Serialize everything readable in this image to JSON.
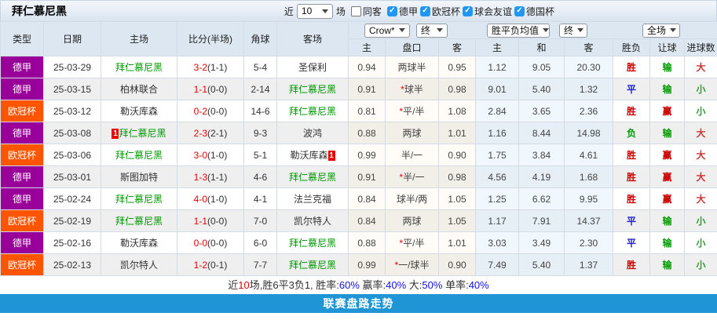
{
  "top_bar": {
    "title": "拜仁慕尼黑",
    "recent_prefix": "近",
    "recent_count": "10",
    "recent_suffix": "场",
    "same_away": {
      "label": "同客",
      "checked": false
    },
    "filters": [
      {
        "label": "德甲",
        "checked": true
      },
      {
        "label": "欧冠杯",
        "checked": true
      },
      {
        "label": "球会友谊",
        "checked": true
      },
      {
        "label": "德国杯",
        "checked": true
      }
    ]
  },
  "header": {
    "cols": [
      "类型",
      "日期",
      "主场",
      "比分(半场)",
      "角球",
      "客场"
    ],
    "selects": [
      {
        "value": "Crow*"
      },
      {
        "value": "终"
      },
      {
        "value": "胜平负均值"
      },
      {
        "value": "终"
      },
      {
        "value": "全场"
      }
    ],
    "subcols": [
      "主",
      "盘口",
      "客",
      "主",
      "和",
      "客",
      "胜负",
      "让球",
      "进球数"
    ]
  },
  "colors": {
    "bundesliga_badge": "#990099",
    "ucl_badge": "#ff5500",
    "team_highlight": "#009900",
    "score_red": "#e60000",
    "accent_bar": "#2095d5",
    "percent_blue": "#1111dd"
  },
  "rows": [
    {
      "cells": [
        {
          "t": "德甲",
          "cls": "type-dejia"
        },
        {
          "t": "25-03-29"
        },
        {
          "t": "拜仁慕尼黑",
          "color": "g"
        },
        {
          "t": "3-2",
          "color": "r",
          "half": "(1-1)"
        },
        {
          "t": "5-4"
        },
        {
          "t": "圣保利"
        },
        {
          "t": "0.94"
        },
        {
          "t": "两球半"
        },
        {
          "t": "0.95"
        },
        {
          "t": "1.12"
        },
        {
          "t": "9.05"
        },
        {
          "t": "20.30"
        },
        {
          "t": "胜",
          "color": "rb"
        },
        {
          "t": "输",
          "color": "gb"
        },
        {
          "t": "大",
          "color": "or"
        }
      ]
    },
    {
      "cells": [
        {
          "t": "德甲",
          "cls": "type-dejia"
        },
        {
          "t": "25-03-15"
        },
        {
          "t": "柏林联合"
        },
        {
          "t": "1-1",
          "color": "r",
          "half": "(0-0)"
        },
        {
          "t": "2-14"
        },
        {
          "t": "拜仁慕尼黑",
          "color": "g"
        },
        {
          "t": "0.91"
        },
        {
          "star": "*",
          "t": "球半"
        },
        {
          "t": "0.98"
        },
        {
          "t": "9.01"
        },
        {
          "t": "5.40"
        },
        {
          "t": "1.32"
        },
        {
          "t": "平",
          "color": "bb"
        },
        {
          "t": "输",
          "color": "gb"
        },
        {
          "t": "小",
          "color": "ug"
        }
      ]
    },
    {
      "cells": [
        {
          "t": "欧冠杯",
          "cls": "type-ouguan"
        },
        {
          "t": "25-03-12"
        },
        {
          "t": "勒沃库森"
        },
        {
          "t": "0-2",
          "color": "r",
          "half": "(0-0)"
        },
        {
          "t": "14-6"
        },
        {
          "t": "拜仁慕尼黑",
          "color": "g"
        },
        {
          "t": "0.81"
        },
        {
          "star": "*",
          "t": "平/半"
        },
        {
          "t": "1.08"
        },
        {
          "t": "2.84"
        },
        {
          "t": "3.65"
        },
        {
          "t": "2.36"
        },
        {
          "t": "胜",
          "color": "rb"
        },
        {
          "t": "赢",
          "color": "rb"
        },
        {
          "t": "小",
          "color": "ug"
        }
      ]
    },
    {
      "cells": [
        {
          "t": "德甲",
          "cls": "type-dejia"
        },
        {
          "t": "25-03-08"
        },
        {
          "t": "拜仁慕尼黑",
          "color": "g",
          "badge": {
            "pos": "before",
            "t": "1"
          }
        },
        {
          "t": "2-3",
          "color": "r",
          "half": "(2-1)"
        },
        {
          "t": "9-3"
        },
        {
          "t": "波鸿"
        },
        {
          "t": "0.88"
        },
        {
          "t": "两球"
        },
        {
          "t": "1.01"
        },
        {
          "t": "1.16"
        },
        {
          "t": "8.44"
        },
        {
          "t": "14.98"
        },
        {
          "t": "负",
          "color": "gb"
        },
        {
          "t": "输",
          "color": "gb"
        },
        {
          "t": "大",
          "color": "or"
        }
      ]
    },
    {
      "cells": [
        {
          "t": "欧冠杯",
          "cls": "type-ouguan"
        },
        {
          "t": "25-03-06"
        },
        {
          "t": "拜仁慕尼黑",
          "color": "g"
        },
        {
          "t": "3-0",
          "color": "r",
          "half": "(1-0)"
        },
        {
          "t": "5-1"
        },
        {
          "t": "勒沃库森",
          "badge": {
            "pos": "after",
            "t": "1"
          }
        },
        {
          "t": "0.99"
        },
        {
          "t": "半/一"
        },
        {
          "t": "0.90"
        },
        {
          "t": "1.75"
        },
        {
          "t": "3.84"
        },
        {
          "t": "4.61"
        },
        {
          "t": "胜",
          "color": "rb"
        },
        {
          "t": "赢",
          "color": "rb"
        },
        {
          "t": "大",
          "color": "or"
        }
      ]
    },
    {
      "cells": [
        {
          "t": "德甲",
          "cls": "type-dejia"
        },
        {
          "t": "25-03-01"
        },
        {
          "t": "斯图加特"
        },
        {
          "t": "1-3",
          "color": "r",
          "half": "(1-1)"
        },
        {
          "t": "4-6"
        },
        {
          "t": "拜仁慕尼黑",
          "color": "g"
        },
        {
          "t": "0.91"
        },
        {
          "star": "*",
          "t": "半/一"
        },
        {
          "t": "0.98"
        },
        {
          "t": "4.56"
        },
        {
          "t": "4.19"
        },
        {
          "t": "1.68"
        },
        {
          "t": "胜",
          "color": "rb"
        },
        {
          "t": "赢",
          "color": "rb"
        },
        {
          "t": "大",
          "color": "or"
        }
      ]
    },
    {
      "cells": [
        {
          "t": "德甲",
          "cls": "type-dejia"
        },
        {
          "t": "25-02-24"
        },
        {
          "t": "拜仁慕尼黑",
          "color": "g"
        },
        {
          "t": "4-0",
          "color": "r",
          "half": "(1-0)"
        },
        {
          "t": "4-1"
        },
        {
          "t": "法兰克福"
        },
        {
          "t": "0.84"
        },
        {
          "t": "球半/两"
        },
        {
          "t": "1.05"
        },
        {
          "t": "1.25"
        },
        {
          "t": "6.62"
        },
        {
          "t": "9.95"
        },
        {
          "t": "胜",
          "color": "rb"
        },
        {
          "t": "赢",
          "color": "rb"
        },
        {
          "t": "大",
          "color": "or"
        }
      ]
    },
    {
      "cells": [
        {
          "t": "欧冠杯",
          "cls": "type-ouguan"
        },
        {
          "t": "25-02-19"
        },
        {
          "t": "拜仁慕尼黑",
          "color": "g"
        },
        {
          "t": "1-1",
          "color": "r",
          "half": "(0-0)"
        },
        {
          "t": "7-0"
        },
        {
          "t": "凯尔特人"
        },
        {
          "t": "0.84"
        },
        {
          "t": "两球"
        },
        {
          "t": "1.05"
        },
        {
          "t": "1.17"
        },
        {
          "t": "7.91"
        },
        {
          "t": "14.37"
        },
        {
          "t": "平",
          "color": "bb"
        },
        {
          "t": "输",
          "color": "gb"
        },
        {
          "t": "小",
          "color": "ug"
        }
      ]
    },
    {
      "cells": [
        {
          "t": "德甲",
          "cls": "type-dejia"
        },
        {
          "t": "25-02-16"
        },
        {
          "t": "勒沃库森"
        },
        {
          "t": "0-0",
          "color": "r",
          "half": "(0-0)"
        },
        {
          "t": "6-0"
        },
        {
          "t": "拜仁慕尼黑",
          "color": "g"
        },
        {
          "t": "0.88"
        },
        {
          "star": "*",
          "t": "平/半"
        },
        {
          "t": "1.01"
        },
        {
          "t": "3.03"
        },
        {
          "t": "3.49"
        },
        {
          "t": "2.30"
        },
        {
          "t": "平",
          "color": "bb"
        },
        {
          "t": "输",
          "color": "gb"
        },
        {
          "t": "小",
          "color": "ug"
        }
      ]
    },
    {
      "cells": [
        {
          "t": "欧冠杯",
          "cls": "type-ouguan"
        },
        {
          "t": "25-02-13"
        },
        {
          "t": "凯尔特人"
        },
        {
          "t": "1-2",
          "color": "r",
          "half": "(0-1)"
        },
        {
          "t": "7-7"
        },
        {
          "t": "拜仁慕尼黑",
          "color": "g"
        },
        {
          "t": "0.99"
        },
        {
          "star": "*",
          "t": "一/球半"
        },
        {
          "t": "0.90"
        },
        {
          "t": "7.49"
        },
        {
          "t": "5.40"
        },
        {
          "t": "1.37"
        },
        {
          "t": "胜",
          "color": "rb"
        },
        {
          "t": "输",
          "color": "gb"
        },
        {
          "t": "小",
          "color": "ug"
        }
      ]
    }
  ],
  "summary": {
    "segments": [
      {
        "t": "近",
        "c": ""
      },
      {
        "t": "10",
        "c": "seg-red"
      },
      {
        "t": "场,胜6平3负1, 胜率:",
        "c": ""
      },
      {
        "t": "60%",
        "c": "seg-blue"
      },
      {
        "t": " 赢率:",
        "c": ""
      },
      {
        "t": "40%",
        "c": "seg-blue"
      },
      {
        "t": " 大:",
        "c": ""
      },
      {
        "t": "50%",
        "c": "seg-blue"
      },
      {
        "t": " 单率:",
        "c": ""
      },
      {
        "t": "40%",
        "c": "seg-blue"
      }
    ]
  },
  "footer_bar": {
    "label": "联赛盘路走势"
  }
}
